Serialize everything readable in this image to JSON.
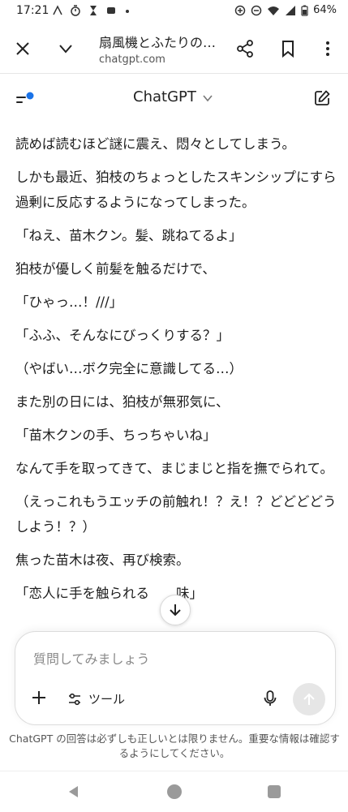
{
  "status": {
    "time": "17:21",
    "battery": "64%"
  },
  "browser": {
    "page_title": "扇風機とふたりの…",
    "url": "chatgpt.com"
  },
  "header": {
    "title": "ChatGPT"
  },
  "messages": [
    "読めば読むほど謎に震え、悶々としてしまう。",
    "しかも最近、狛枝のちょっとしたスキンシップにすら過剰に反応するようになってしまった。",
    "「ねえ、苗木クン。髪、跳ねてるよ」",
    "狛枝が優しく前髪を触るだけで、",
    "「ひゃっ…！///」",
    "「ふふ、そんなにびっくりする？」",
    "（やばい…ボク完全に意識してる…）",
    "また別の日には、狛枝が無邪気に、",
    "「苗木クンの手、ちっちゃいね」",
    "なんて手を取ってきて、まじまじと指を撫でられて。",
    "（えっこれもうエッチの前触れ！？え！？どどどどうしよう！？）",
    "焦った苗木は夜、再び検索。",
    "「恋人に手を触られる　　味」"
  ],
  "composer": {
    "placeholder": "質問してみましょう",
    "tools_label": "ツール"
  },
  "disclaimer": "ChatGPT の回答は必ずしも正しいとは限りません。重要な情報は確認するようにしてください。",
  "icons": {
    "accent": "#1a73e8"
  }
}
